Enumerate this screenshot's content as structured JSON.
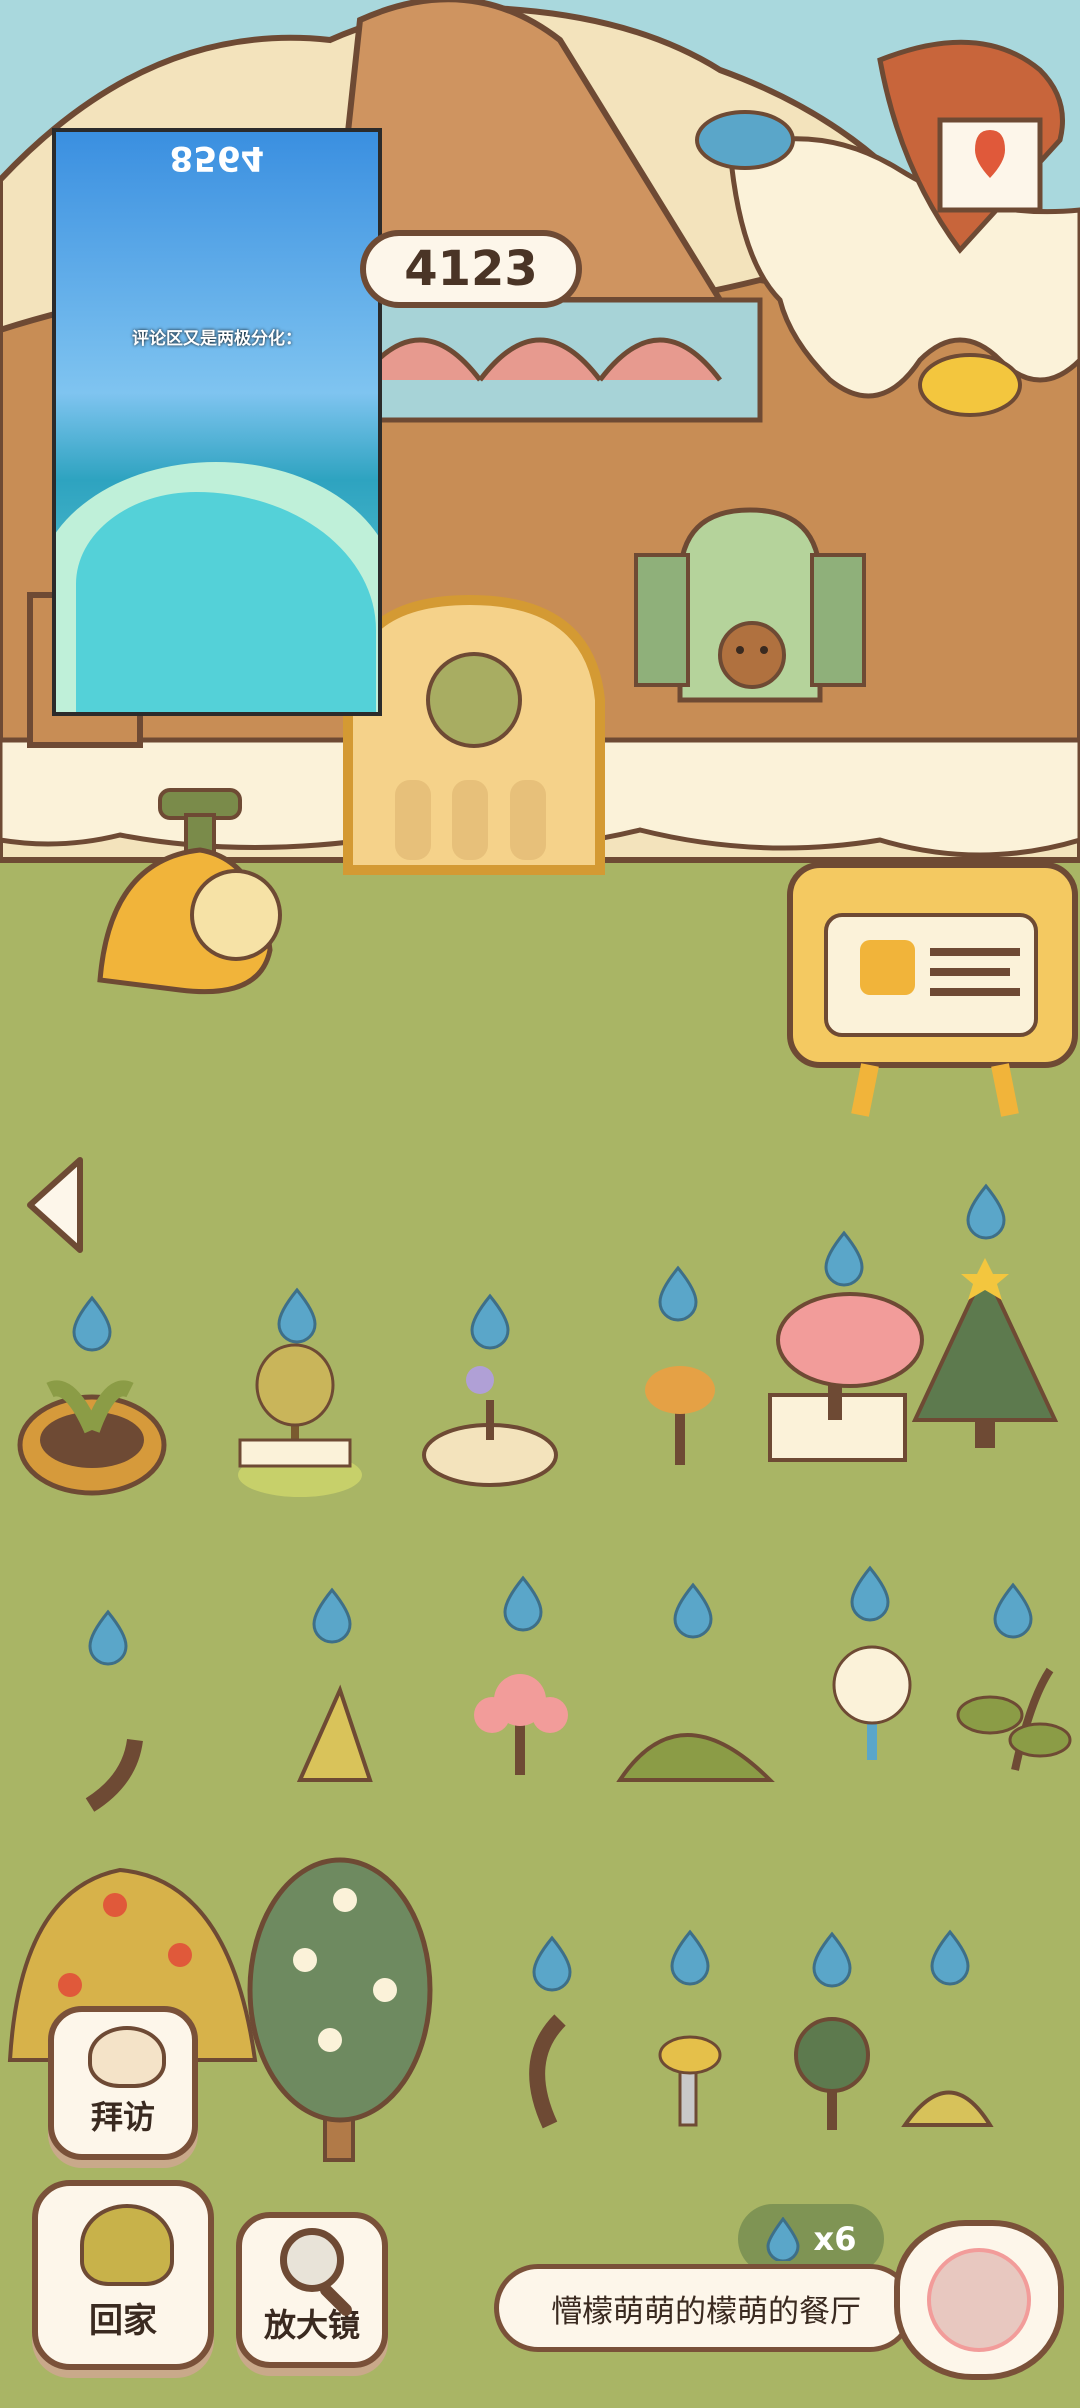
{
  "video_overlay": {
    "counter": "8564",
    "caption": "评论区又是两极分化："
  },
  "hud": {
    "coins": "4123"
  },
  "water": {
    "count": "x6"
  },
  "restaurant": {
    "name": "懵檬萌萌的檬萌的餐厅"
  },
  "buttons": {
    "visit": "拜访",
    "home": "回家",
    "magnifier": "放大镜"
  },
  "icons": {
    "map": "map-icon",
    "back": "back-arrow-icon",
    "water_drop": "water-drop-icon"
  }
}
